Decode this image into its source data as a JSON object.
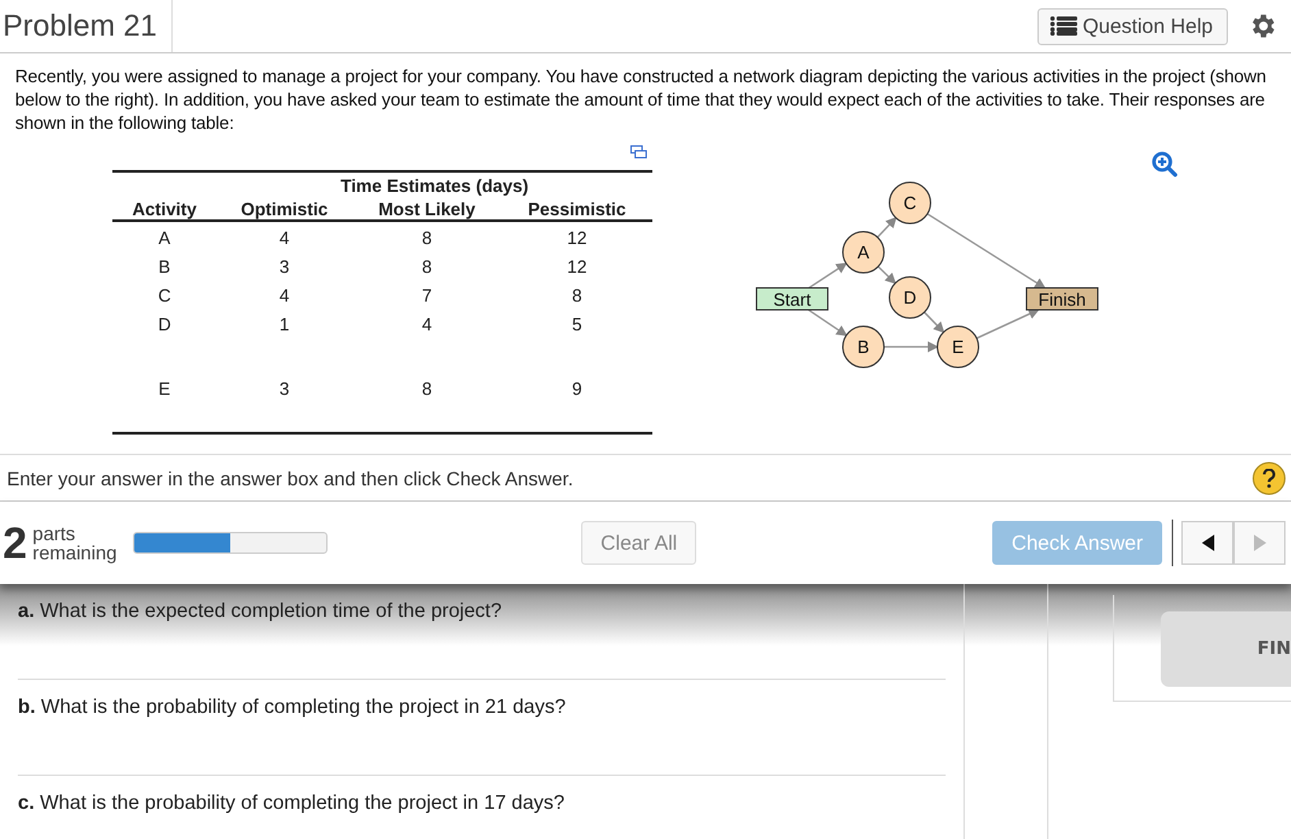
{
  "header": {
    "title": "Problem 21",
    "help_button": "Question Help"
  },
  "intro": "Recently, you were assigned to manage a project for your company. You have constructed a network diagram depicting the various activities in the project (shown below to the right). In addition, you have asked your team to estimate the amount of time that they would expect each of the activities to take. Their responses are shown in the following table:",
  "table": {
    "group_heading": "Time Estimates (days)",
    "columns": [
      "Activity",
      "Optimistic",
      "Most Likely",
      "Pessimistic"
    ],
    "rows": [
      [
        "A",
        "4",
        "8",
        "12"
      ],
      [
        "B",
        "3",
        "8",
        "12"
      ],
      [
        "C",
        "4",
        "7",
        "8"
      ],
      [
        "D",
        "1",
        "4",
        "5"
      ],
      [
        "E",
        "3",
        "8",
        "9"
      ]
    ]
  },
  "diagram": {
    "nodes": [
      {
        "label": "Start",
        "kind": "start"
      },
      {
        "label": "A",
        "kind": "activity"
      },
      {
        "label": "C",
        "kind": "activity"
      },
      {
        "label": "D",
        "kind": "activity"
      },
      {
        "label": "B",
        "kind": "activity"
      },
      {
        "label": "E",
        "kind": "activity"
      },
      {
        "label": "Finish",
        "kind": "finish"
      }
    ]
  },
  "instruction": "Enter your answer in the answer box and then click Check Answer.",
  "toolbar": {
    "parts_count": "2",
    "parts_label": "parts",
    "remaining_label": "remaining",
    "progress": {
      "level": 0.5
    },
    "clear_button": "Clear All",
    "check_button": "Check Answer",
    "check_disabled": true,
    "prev_disabled": false,
    "next_disabled": true
  },
  "questions": [
    {
      "letter": "a.",
      "text": "What is the expected completion time of the project?"
    },
    {
      "letter": "b.",
      "text": "What is the probability of completing the project in 21 days?"
    },
    {
      "letter": "c.",
      "text": "What is the probability of completing the project in 17 days?"
    }
  ],
  "side_button": "FIN"
}
